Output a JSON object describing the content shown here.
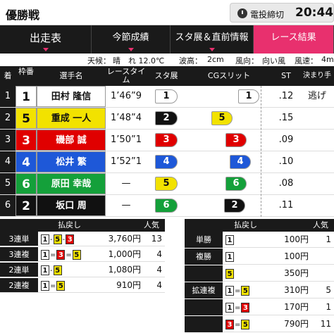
{
  "header": {
    "title": "優勝戦",
    "deadline_label": "電投締切",
    "deadline_time": "20:44"
  },
  "tabs": [
    {
      "label": "出走表",
      "active": false
    },
    {
      "label": "今節成績",
      "active": false
    },
    {
      "label": "スタ展＆直前情報",
      "active": false
    },
    {
      "label": "レース結果",
      "active": true
    }
  ],
  "weather": {
    "label_weather": "天候：",
    "weather": "晴",
    "temp": "れ 12.0℃",
    "label_wave": "波高：",
    "wave": "2cm",
    "label_wind": "風向：",
    "wind": "向い風",
    "label_windspeed": "風速：",
    "windspeed": "4m"
  },
  "columns": {
    "rank": "着",
    "lane": "枠番",
    "name": "選手名",
    "time": "レースタイム",
    "sta": "スタ展",
    "cg": "CGスリット",
    "st": "ST",
    "kimarite": "決まり手"
  },
  "results": [
    {
      "rank": "1",
      "lane": "1",
      "name": "田村 隆信",
      "time": "1’46”9",
      "sta": "1",
      "st": ".12",
      "kimarite": "逃げ",
      "lane_bg": "#ffffff",
      "lane_fg": "#111111"
    },
    {
      "rank": "2",
      "lane": "5",
      "name": "重成 一人",
      "time": "1’48”4",
      "sta": "2",
      "st": ".15",
      "kimarite": "",
      "lane_bg": "#f2e200",
      "lane_fg": "#111111"
    },
    {
      "rank": "3",
      "lane": "3",
      "name": "磯部 誠",
      "time": "1’50”1",
      "sta": "3",
      "st": ".09",
      "kimarite": "",
      "lane_bg": "#e00000",
      "lane_fg": "#ffffff"
    },
    {
      "rank": "4",
      "lane": "4",
      "name": "松井 繁",
      "time": "1’52”1",
      "sta": "4",
      "st": ".10",
      "kimarite": "",
      "lane_bg": "#1e58d8",
      "lane_fg": "#ffffff"
    },
    {
      "rank": "5",
      "lane": "6",
      "name": "原田 幸哉",
      "time": "—",
      "sta": "5",
      "st": ".08",
      "kimarite": "",
      "lane_bg": "#14a03a",
      "lane_fg": "#ffffff"
    },
    {
      "rank": "6",
      "lane": "2",
      "name": "坂口 周",
      "time": "—",
      "sta": "6",
      "st": ".11",
      "kimarite": "",
      "lane_bg": "#111111",
      "lane_fg": "#ffffff"
    }
  ],
  "payouts_left_header": {
    "refund": "払戻し",
    "popular": "人気"
  },
  "payouts_right_header": {
    "refund": "払戻し",
    "popular": "人気"
  },
  "payouts_left": [
    {
      "label": "3連単",
      "combo": [
        "1",
        "5",
        "3"
      ],
      "seps": [
        "-",
        "-"
      ],
      "amount": "3,760円",
      "pop": "13"
    },
    {
      "label": "3連複",
      "combo": [
        "1",
        "3",
        "5"
      ],
      "seps": [
        "=",
        "="
      ],
      "amount": "1,000円",
      "pop": "4"
    },
    {
      "label": "2連単",
      "combo": [
        "1",
        "5"
      ],
      "seps": [
        "-"
      ],
      "amount": "1,080円",
      "pop": "4"
    },
    {
      "label": "2連複",
      "combo": [
        "1",
        "5"
      ],
      "seps": [
        "="
      ],
      "amount": "910円",
      "pop": "4"
    }
  ],
  "payouts_right": [
    {
      "label": "単勝",
      "combo": [
        "1"
      ],
      "seps": [],
      "amount": "100円",
      "pop": "1"
    },
    {
      "label": "複勝",
      "combo": [
        "1"
      ],
      "seps": [],
      "amount": "100円",
      "pop": ""
    },
    {
      "label": "",
      "combo": [
        "5"
      ],
      "seps": [],
      "amount": "350円",
      "pop": ""
    },
    {
      "label": "拡連複",
      "combo": [
        "1",
        "5"
      ],
      "seps": [
        "="
      ],
      "amount": "310円",
      "pop": "5"
    },
    {
      "label": "",
      "combo": [
        "1",
        "3"
      ],
      "seps": [
        "="
      ],
      "amount": "170円",
      "pop": "1"
    },
    {
      "label": "",
      "combo": [
        "3",
        "5"
      ],
      "seps": [
        "="
      ],
      "amount": "790円",
      "pop": "11"
    }
  ],
  "colors": {
    "1": "#ffffff",
    "2": "#111111",
    "3": "#e00000",
    "4": "#1e58d8",
    "5": "#f2e200",
    "6": "#14a03a",
    "accent": "#e8306e"
  }
}
